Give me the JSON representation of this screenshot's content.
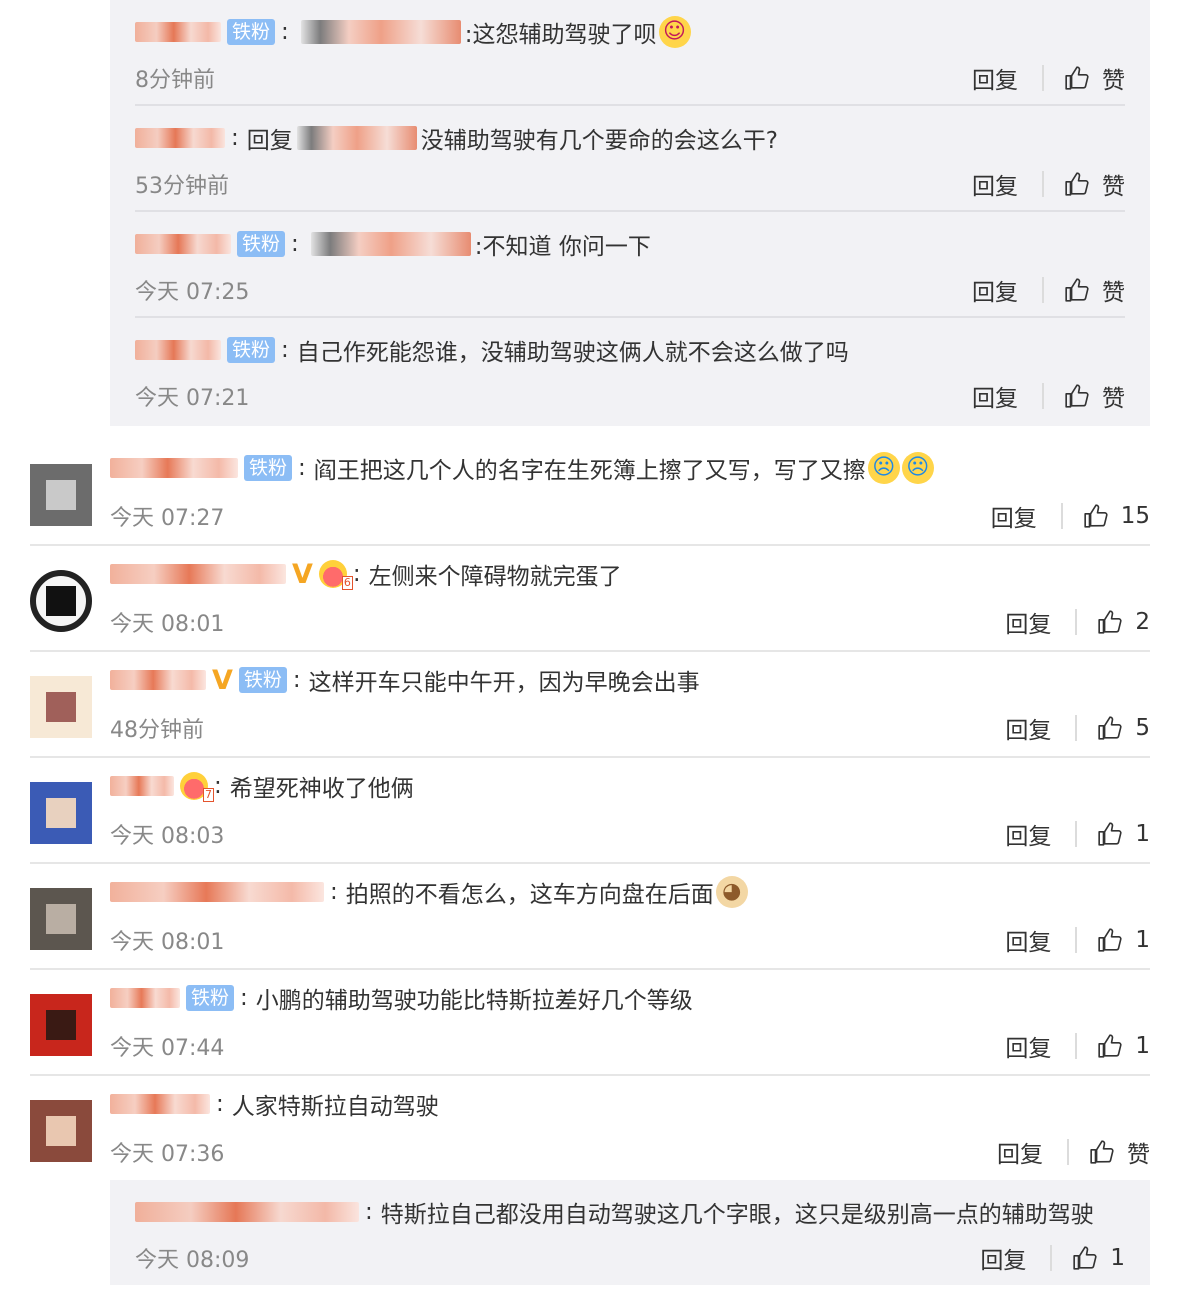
{
  "labels": {
    "reply": "回复",
    "like": "赞",
    "badge_fan": "铁粉"
  },
  "replies_top": [
    {
      "text_before": "",
      "text": ":这怨辅助驾驶了呗",
      "time": "8分钟前"
    },
    {
      "text_before": "回复",
      "text": "没辅助驾驶有几个要命的会这么干?",
      "time": "53分钟前"
    },
    {
      "text_before": "",
      "text": ":不知道  你问一下",
      "time": "今天 07:25"
    },
    {
      "text_before": "",
      "text": "自己作死能怨谁，没辅助驾驶这俩人就不会这么做了吗",
      "time": "今天 07:21"
    }
  ],
  "comments": [
    {
      "text": "阎王把这几个人的名字在生死簿上擦了又写，写了又擦",
      "time": "今天 07:27",
      "likes": "15"
    },
    {
      "text": "左侧来个障碍物就完蛋了",
      "time": "今天 08:01",
      "likes": "2"
    },
    {
      "text": "这样开车只能中午开，因为早晚会出事",
      "time": "48分钟前",
      "likes": "5"
    },
    {
      "text": "希望死神收了他俩",
      "time": "今天 08:03",
      "likes": "1"
    },
    {
      "text": "拍照的不看怎么，这车方向盘在后面",
      "time": "今天 08:01",
      "likes": "1"
    },
    {
      "text": "小鹏的辅助驾驶功能比特斯拉差好几个等级",
      "time": "今天 07:44",
      "likes": "1"
    },
    {
      "text": "人家特斯拉自动驾驶",
      "time": "今天 07:36",
      "likes": "赞"
    }
  ],
  "reply_bottom": {
    "text": "特斯拉自己都没用自动驾驶这几个字眼，这只是级别高一点的辅助驾驶",
    "time": "今天 08:09",
    "likes": "1"
  },
  "colors": {
    "accent_name": "#e46a45",
    "badge": "#8cbdf5",
    "vip": "#f5a623",
    "reply_bg": "#f2f2f5"
  }
}
